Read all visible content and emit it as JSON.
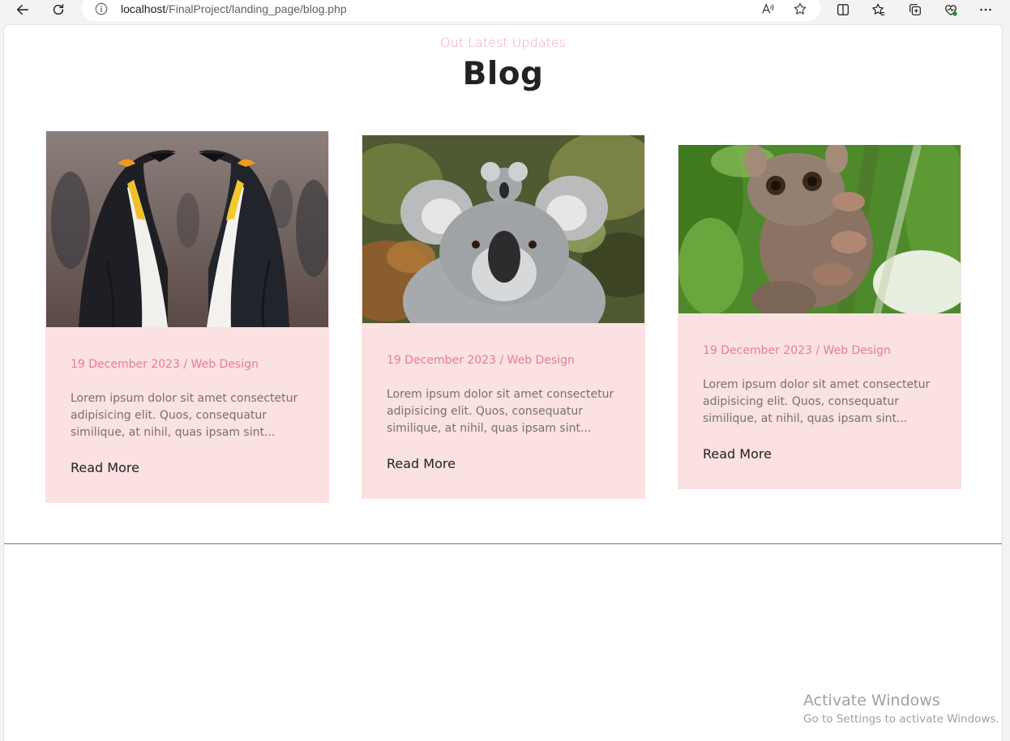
{
  "browser": {
    "url_host": "localhost",
    "url_path": "/FinalProject/landing_page/blog.php",
    "icons": [
      "back-arrow-icon",
      "refresh-icon",
      "site-info-icon",
      "read-aloud-icon",
      "favorite-star-icon",
      "split-screen-icon",
      "favorites-icon",
      "collections-icon",
      "browser-essentials-icon",
      "more-options-icon"
    ]
  },
  "page": {
    "subtitle": "Out Latest Updates",
    "title": "Blog",
    "colors": {
      "accent": "#f4a7c0",
      "card_bg": "#fbe1e1",
      "meta": "#e47f91"
    }
  },
  "posts": [
    {
      "image": "penguins-photo",
      "meta": "19 December 2023 / Web Design",
      "excerpt": "Lorem ipsum dolor sit amet consectetur adipisicing elit. Quos, consequatur similique, at nihil, quas ipsam sint...",
      "read_more": "Read More"
    },
    {
      "image": "koala-photo",
      "meta": "19 December 2023 / Web Design",
      "excerpt": "Lorem ipsum dolor sit amet consectetur adipisicing elit. Quos, consequatur similique, at nihil, quas ipsam sint...",
      "read_more": "Read More"
    },
    {
      "image": "tarsier-photo",
      "meta": "19 December 2023 / Web Design",
      "excerpt": "Lorem ipsum dolor sit amet consectetur adipisicing elit. Quos, consequatur similique, at nihil, quas ipsam sint...",
      "read_more": "Read More"
    }
  ],
  "os_watermark": {
    "line1": "Activate Windows",
    "line2": "Go to Settings to activate Windows."
  }
}
